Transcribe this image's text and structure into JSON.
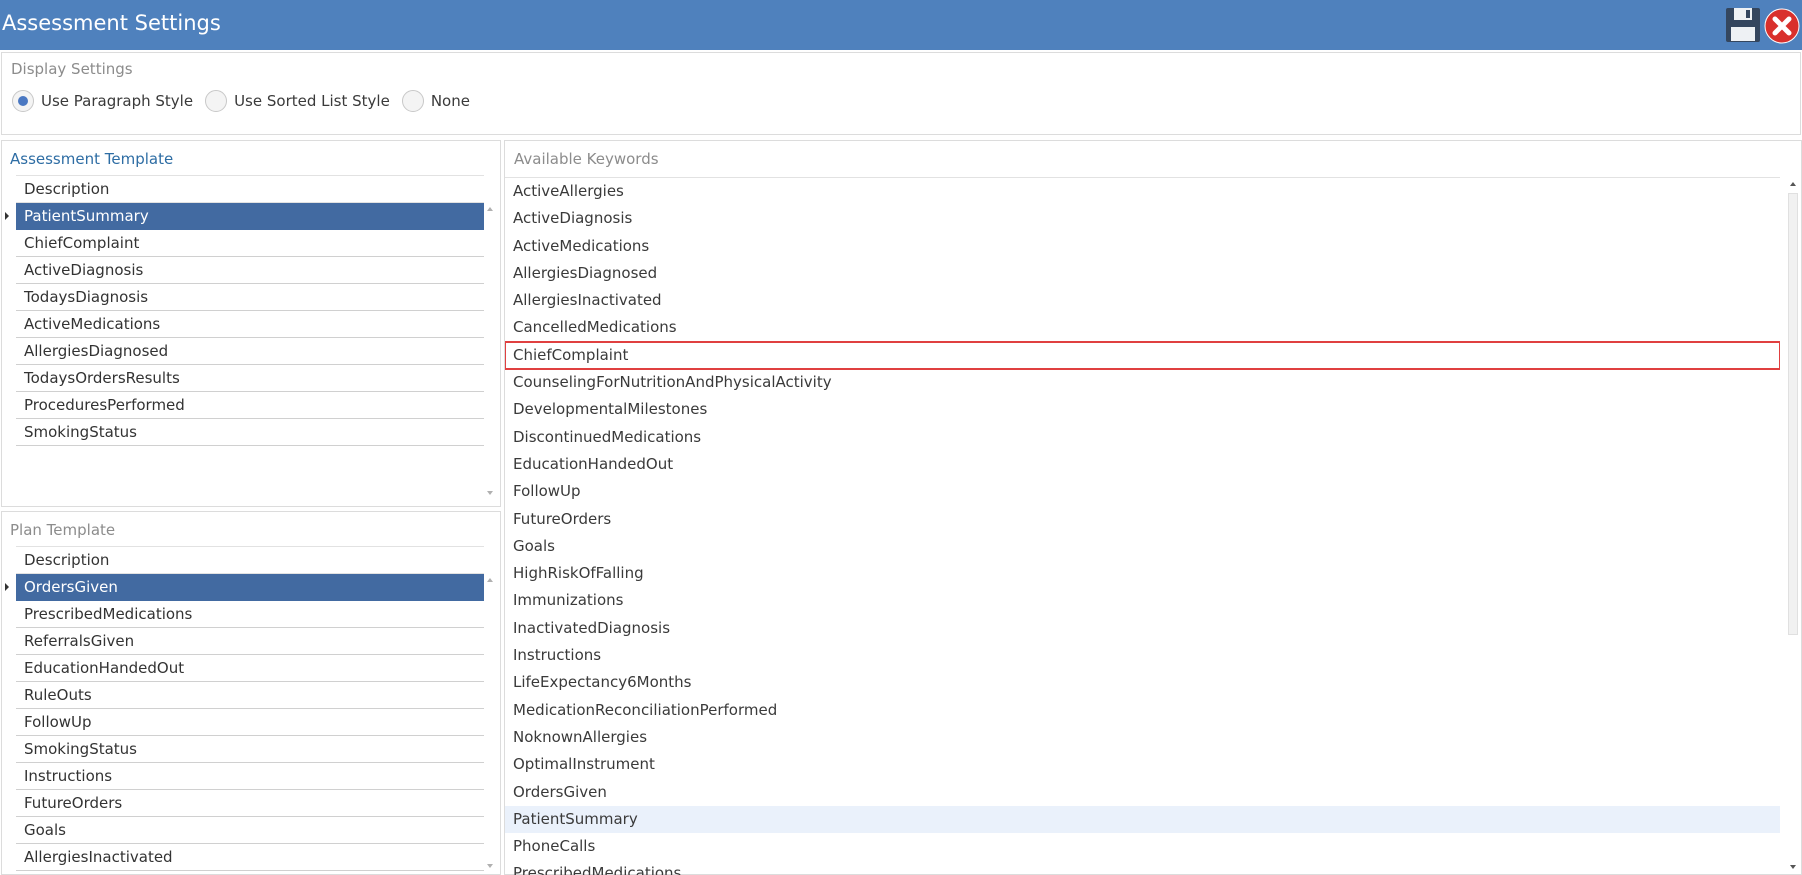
{
  "window": {
    "title": "Assessment Settings"
  },
  "display_settings": {
    "label": "Display Settings",
    "options": [
      {
        "label": "Use Paragraph Style",
        "checked": true
      },
      {
        "label": "Use Sorted List Style",
        "checked": false
      },
      {
        "label": "None",
        "checked": false
      }
    ]
  },
  "assessment_template": {
    "label": "Assessment Template",
    "column_header": "Description",
    "rows": [
      "PatientSummary",
      "ChiefComplaint",
      "ActiveDiagnosis",
      "TodaysDiagnosis",
      "ActiveMedications",
      "AllergiesDiagnosed",
      "TodaysOrdersResults",
      "ProceduresPerformed",
      "SmokingStatus"
    ],
    "selected": "PatientSummary"
  },
  "plan_template": {
    "label": "Plan Template",
    "column_header": "Description",
    "rows": [
      "OrdersGiven",
      "PrescribedMedications",
      "ReferralsGiven",
      "EducationHandedOut",
      "RuleOuts",
      "FollowUp",
      "SmokingStatus",
      "Instructions",
      "FutureOrders",
      "Goals",
      "AllergiesInactivated"
    ],
    "selected": "OrdersGiven"
  },
  "available_keywords": {
    "label": "Available Keywords",
    "items": [
      "ActiveAllergies",
      "ActiveDiagnosis",
      "ActiveMedications",
      "AllergiesDiagnosed",
      "AllergiesInactivated",
      "CancelledMedications",
      "ChiefComplaint",
      "CounselingForNutritionAndPhysicalActivity",
      "DevelopmentalMilestones",
      "DiscontinuedMedications",
      "EducationHandedOut",
      "FollowUp",
      "FutureOrders",
      "Goals",
      "HighRiskOfFalling",
      "Immunizations",
      "InactivatedDiagnosis",
      "Instructions",
      "LifeExpectancy6Months",
      "MedicationReconciliationPerformed",
      "NoknownAllergies",
      "OptimalInstrument",
      "OrdersGiven",
      "PatientSummary",
      "PhoneCalls",
      "PrescribedMedications"
    ],
    "highlighted": "ChiefComplaint",
    "hovered": "PatientSummary"
  },
  "colors": {
    "titlebar": "#4f81bd",
    "selected_row": "#426aa1",
    "highlight_border": "#e04040",
    "hover_row": "#eaf1fb"
  },
  "icons": {
    "save": "floppy-disk-icon",
    "close": "close-x-icon"
  }
}
